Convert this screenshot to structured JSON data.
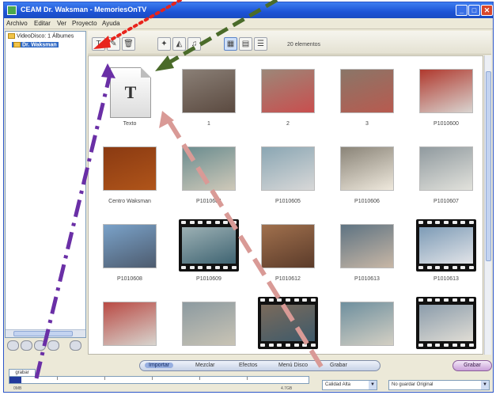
{
  "window": {
    "title": "CEAM Dr. Waksman - MemoriesOnTV",
    "controls": {
      "minimize": "_",
      "maximize": "□",
      "close": "✕"
    }
  },
  "menu": {
    "items": [
      "Archivo",
      "Editar",
      "Ver",
      "Proyecto",
      "Ayuda"
    ]
  },
  "tree": {
    "root": "VideoDisco: 1 Álbumes",
    "album": "Dr. Waksman"
  },
  "toolbar": {
    "count_label": "20 elementos",
    "icons": [
      "text-icon",
      "new-icon",
      "delete-icon",
      "effects-icon",
      "effects2-icon",
      "music-icon",
      "view-large-icon",
      "view-medium-icon",
      "view-list-icon"
    ]
  },
  "gallery": {
    "items": [
      {
        "caption": "Texto",
        "kind": "text",
        "colors": [
          "#f4f4f4",
          "#cccccc"
        ]
      },
      {
        "caption": "1",
        "kind": "photo",
        "colors": [
          "#8a7f76",
          "#5b4a40"
        ]
      },
      {
        "caption": "2",
        "kind": "photo",
        "colors": [
          "#9c8778",
          "#c94e4e"
        ]
      },
      {
        "caption": "3",
        "kind": "photo",
        "colors": [
          "#8a7668",
          "#b85a4f"
        ]
      },
      {
        "caption": "P1010600",
        "kind": "photo",
        "colors": [
          "#b0392e",
          "#d9d4d0"
        ]
      },
      {
        "caption": "Centro Waksman",
        "kind": "photo",
        "colors": [
          "#8a3a12",
          "#b0551a"
        ]
      },
      {
        "caption": "P1010604",
        "kind": "photo",
        "colors": [
          "#6a8c8f",
          "#cfc9b9"
        ]
      },
      {
        "caption": "P1010605",
        "kind": "photo",
        "colors": [
          "#8aa6b3",
          "#d8d8d8"
        ]
      },
      {
        "caption": "P1010606",
        "kind": "photo",
        "colors": [
          "#8a8478",
          "#efe9dd"
        ]
      },
      {
        "caption": "P1010607",
        "kind": "photo",
        "colors": [
          "#909a9f",
          "#e2e2dc"
        ]
      },
      {
        "caption": "P1010608",
        "kind": "photo",
        "colors": [
          "#7aa2c9",
          "#4d5b6e"
        ]
      },
      {
        "caption": "P1010609",
        "kind": "video",
        "colors": [
          "#9cb0b4",
          "#3f6472"
        ]
      },
      {
        "caption": "P1010612",
        "kind": "photo",
        "colors": [
          "#a0704d",
          "#5b3b2a"
        ]
      },
      {
        "caption": "P1010613",
        "kind": "photo",
        "colors": [
          "#5e7382",
          "#c8b7a6"
        ]
      },
      {
        "caption": "P1010613",
        "kind": "video",
        "colors": [
          "#7d9bb6",
          "#e2e4e8"
        ]
      },
      {
        "caption": "",
        "kind": "photo",
        "colors": [
          "#b94a44",
          "#d8d5cf"
        ]
      },
      {
        "caption": "",
        "kind": "photo",
        "colors": [
          "#8c9aa0",
          "#c9c4b5"
        ]
      },
      {
        "caption": "",
        "kind": "video",
        "colors": [
          "#7a6a5b",
          "#3e5a6a"
        ]
      },
      {
        "caption": "",
        "kind": "photo",
        "colors": [
          "#6e8f9e",
          "#d4d0c4"
        ]
      },
      {
        "caption": "",
        "kind": "video",
        "colors": [
          "#8b9cab",
          "#e0ddd5"
        ]
      }
    ]
  },
  "bottom": {
    "tabs": [
      "Importar",
      "Mezclar",
      "Efectos",
      "Menú Disco",
      "Grabar"
    ],
    "active_tab": "Importar",
    "grabar_button": "Grabar",
    "grabar_tab_label": "grabar",
    "progress_value": 0.04,
    "progress_left_label": "0MB",
    "progress_right_label": "4.7GB",
    "disc_select": "Calidad Alta",
    "quality_select": "No guardar Original"
  },
  "annotations": {
    "arrow_colors": {
      "red": "#e8241c",
      "green": "#4a6b2a",
      "purple": "#6a2fa6",
      "pink": "#d99a96"
    }
  }
}
